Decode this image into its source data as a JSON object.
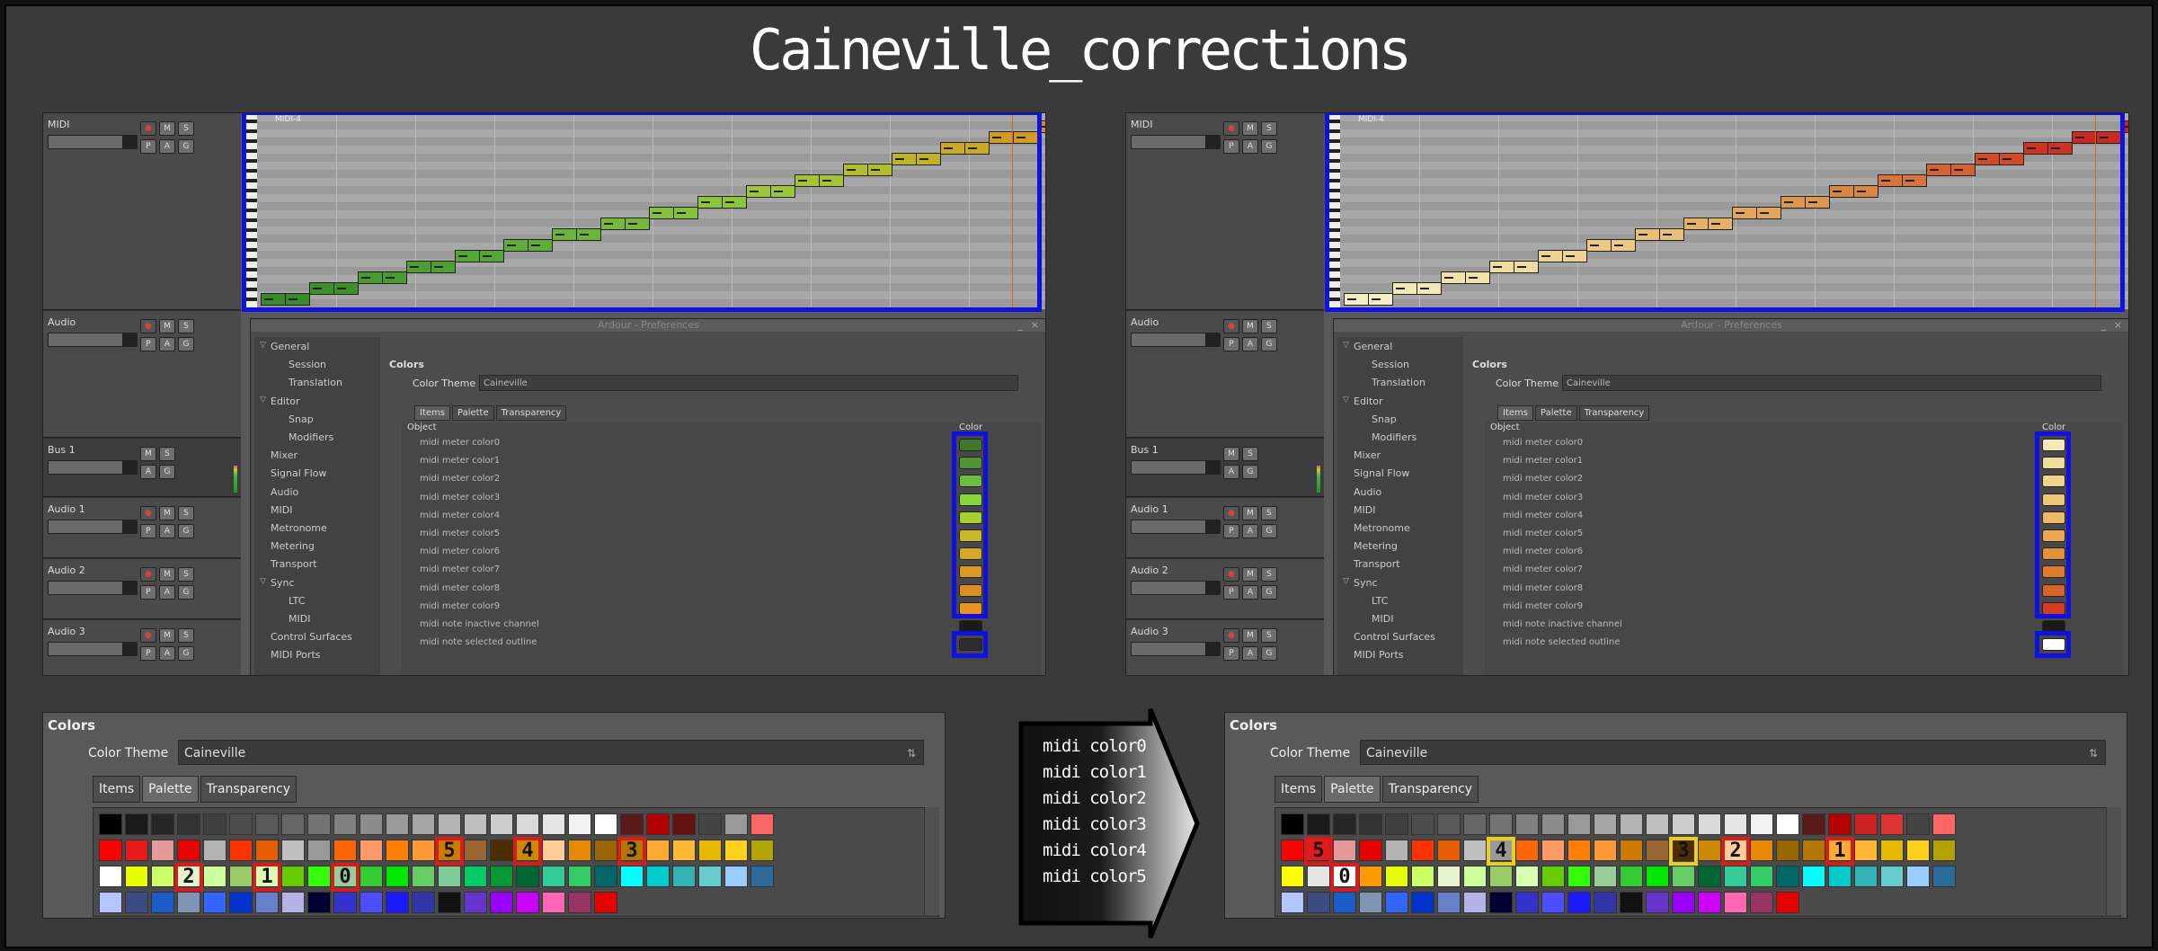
{
  "title": "Caineville_corrections",
  "track_names": [
    "MIDI",
    "Audio",
    "Bus 1",
    "Audio 1",
    "Audio 2",
    "Audio 3"
  ],
  "track_buttons": {
    "m": "M",
    "s": "S",
    "p": "P",
    "a": "A",
    "g": "G"
  },
  "region_name": "MIDI-4",
  "prefs": {
    "window_title": "Ardour - Preferences",
    "min_btn": "_",
    "close_btn": "×",
    "tree": [
      {
        "label": "General",
        "level": 0,
        "expander": true
      },
      {
        "label": "Session",
        "level": 1
      },
      {
        "label": "Translation",
        "level": 1
      },
      {
        "label": "Editor",
        "level": 0,
        "expander": true
      },
      {
        "label": "Snap",
        "level": 1
      },
      {
        "label": "Modifiers",
        "level": 1
      },
      {
        "label": "Mixer",
        "level": 0
      },
      {
        "label": "Signal Flow",
        "level": 0
      },
      {
        "label": "Audio",
        "level": 0
      },
      {
        "label": "MIDI",
        "level": 0
      },
      {
        "label": "Metronome",
        "level": 0
      },
      {
        "label": "Metering",
        "level": 0
      },
      {
        "label": "Transport",
        "level": 0
      },
      {
        "label": "Sync",
        "level": 0,
        "expander": true
      },
      {
        "label": "LTC",
        "level": 1
      },
      {
        "label": "MIDI",
        "level": 1
      },
      {
        "label": "Control Surfaces",
        "level": 0
      },
      {
        "label": "MIDI Ports",
        "level": 0
      }
    ],
    "section": "Colors",
    "theme_label": "Color Theme",
    "theme_value": "Caineville",
    "tabs": [
      "Items",
      "Palette",
      "Transparency"
    ],
    "col_object": "Object",
    "col_color": "Color",
    "objects": [
      "midi meter color0",
      "midi meter color1",
      "midi meter color2",
      "midi meter color3",
      "midi meter color4",
      "midi meter color5",
      "midi meter color6",
      "midi meter color7",
      "midi meter color8",
      "midi meter color9",
      "midi note inactive channel",
      "midi note selected outline"
    ]
  },
  "left_swatches": [
    "#3f7a2a",
    "#4e9434",
    "#6cbf3e",
    "#8ad43c",
    "#a7cf32",
    "#c8b92a",
    "#d4a82a",
    "#d99a25",
    "#de8e22",
    "#e69520",
    "#1a1a1a",
    "#2c2c2c"
  ],
  "right_swatches": [
    "#f2e8b8",
    "#f0dd9e",
    "#efd48a",
    "#edc878",
    "#ecba63",
    "#e8a84f",
    "#e29138",
    "#dd7b2c",
    "#d96325",
    "#d83d22",
    "#1a1a1a",
    "#ffffff"
  ],
  "left_notes_colors": [
    "#3a8a2a",
    "#3f8f2b",
    "#479a30",
    "#4d9e33",
    "#56a636",
    "#5fae38",
    "#6bb43a",
    "#77ba3b",
    "#84c03c",
    "#8fc53b",
    "#9cc637",
    "#a6c432",
    "#b2bd2c",
    "#bfb428",
    "#c9a824",
    "#d19c22",
    "#d69020"
  ],
  "right_notes_colors": [
    "#f6eec5",
    "#f4e8b6",
    "#f2e2aa",
    "#f0dc9e",
    "#eed493",
    "#ecca85",
    "#e9bf78",
    "#e6b26a",
    "#e2a55d",
    "#de974f",
    "#da8743",
    "#d77439",
    "#d46131",
    "#d04b2a",
    "#cc3323",
    "#c92a22",
    "#c62220"
  ],
  "bottom": {
    "section": "Colors",
    "theme_label": "Color Theme",
    "theme_value": "Caineville",
    "tabs": [
      "Items",
      "Palette",
      "Transparency"
    ]
  },
  "left_palette": [
    [
      "#000000",
      "#1a1a1a",
      "#262626",
      "#333333",
      "#404040",
      "#4d4d4d",
      "#595959",
      "#666666",
      "#737373",
      "#808080",
      "#8c8c8c",
      "#999999",
      "#a6a6a6",
      "#b3b3b3",
      "#bfbfbf",
      "#cccccc",
      "#d9d9d9",
      "#e6e6e6",
      "#f2f2f2",
      "#ffffff",
      "#5a1a1a",
      "#b30000",
      "#661111",
      "#444444",
      "#999999",
      "#ff6666"
    ],
    [
      "#ff0000",
      "#e61a1a",
      "#e69999",
      "#e60000",
      "#b3b3b3",
      "#ff3300",
      "#e65c00",
      "#bfbfbf",
      "#999999",
      "#ff6600",
      "#ff9966",
      "#ff8000",
      "#ff9933",
      "#cc7a00",
      "#996633",
      "#4d2e00",
      "#cc8800",
      "#ffcc99",
      "#e68a00",
      "#996600",
      "#b37700",
      "#ffaa33",
      "#ffb833",
      "#e6b800",
      "#ffd11a",
      "#b3a300"
    ],
    [
      "#ffffff",
      "#e6ff00",
      "#ccff66",
      "#e6f2cc",
      "#ccff99",
      "#99cc66",
      "#d9ffb3",
      "#66cc00",
      "#33ff00",
      "#99cc99",
      "#33cc33",
      "#00e600",
      "#66cc66",
      "#80cc99",
      "#00cc66",
      "#009933",
      "#006633",
      "#33cc99",
      "#33cc66",
      "#006666",
      "#00ffff",
      "#00cccc",
      "#33b3b3",
      "#66cccc",
      "#99ccff",
      "#2a6b99"
    ],
    [
      "#b3c6ff",
      "#3d4c80",
      "#1a5cc9",
      "#8094b3",
      "#3366ff",
      "#0033cc",
      "#6680cc",
      "#b3b3e6",
      "#000033",
      "#3333cc",
      "#4d4dff",
      "#1a1aff",
      "#3333aa",
      "#111111",
      "#6633cc",
      "#9900ff",
      "#cc00ff",
      "#ff66b3",
      "#993366",
      "#e60000"
    ]
  ],
  "right_palette": [
    [
      "#000000",
      "#1a1a1a",
      "#262626",
      "#333333",
      "#404040",
      "#4d4d4d",
      "#595959",
      "#666666",
      "#737373",
      "#808080",
      "#8c8c8c",
      "#999999",
      "#a6a6a6",
      "#b3b3b3",
      "#bfbfbf",
      "#cccccc",
      "#d9d9d9",
      "#e6e6e6",
      "#f2f2f2",
      "#ffffff",
      "#5a1a1a",
      "#b30000",
      "#cc2222",
      "#dd3333",
      "#444444",
      "#ff6666"
    ],
    [
      "#ff0000",
      "#e61a1a",
      "#e69999",
      "#e60000",
      "#b3b3b3",
      "#ff3300",
      "#e65c00",
      "#bfbfbf",
      "#999999",
      "#ff6600",
      "#ff9966",
      "#ff8000",
      "#ff9933",
      "#cc7a00",
      "#996633",
      "#4d2e00",
      "#cc8800",
      "#ffcc99",
      "#e68a00",
      "#996600",
      "#b37700",
      "#ffaa33",
      "#ffb833",
      "#e6b800",
      "#ffd11a",
      "#b3a300"
    ],
    [
      "#ffff00",
      "#e6e6e6",
      "#ffffff",
      "#ff9900",
      "#e6ff00",
      "#ccff66",
      "#e6f2cc",
      "#ccff99",
      "#99cc66",
      "#d9ffb3",
      "#66cc00",
      "#33ff00",
      "#99cc99",
      "#33cc33",
      "#00e600",
      "#66cc66",
      "#006633",
      "#33cc99",
      "#33cc66",
      "#006666",
      "#00ffff",
      "#00cccc",
      "#33b3b3",
      "#66cccc",
      "#99ccff",
      "#2a6b99"
    ],
    [
      "#b3c6ff",
      "#3d4c80",
      "#1a5cc9",
      "#8094b3",
      "#3366ff",
      "#0033cc",
      "#6680cc",
      "#b3b3e6",
      "#000033",
      "#3333cc",
      "#4d4dff",
      "#1a1aff",
      "#3333aa",
      "#111111",
      "#6633cc",
      "#9900ff",
      "#cc00ff",
      "#ff66b3",
      "#993366",
      "#e60000"
    ]
  ],
  "left_marks": [
    {
      "label": "5",
      "row": 1,
      "col": 13,
      "kind": "red"
    },
    {
      "label": "4",
      "row": 1,
      "col": 16,
      "kind": "red"
    },
    {
      "label": "3",
      "row": 1,
      "col": 20,
      "kind": "red"
    },
    {
      "label": "2",
      "row": 2,
      "col": 3,
      "kind": "red"
    },
    {
      "label": "1",
      "row": 2,
      "col": 6,
      "kind": "red"
    },
    {
      "label": "0",
      "row": 2,
      "col": 9,
      "kind": "red"
    }
  ],
  "right_marks": [
    {
      "label": "5",
      "row": 1,
      "col": 1,
      "kind": "red"
    },
    {
      "label": "4",
      "row": 1,
      "col": 8,
      "kind": "yellow"
    },
    {
      "label": "3",
      "row": 1,
      "col": 15,
      "kind": "yellow"
    },
    {
      "label": "2",
      "row": 1,
      "col": 17,
      "kind": "red"
    },
    {
      "label": "1",
      "row": 1,
      "col": 21,
      "kind": "red"
    },
    {
      "label": "0",
      "row": 2,
      "col": 2,
      "kind": "red"
    }
  ],
  "arrow_lines": [
    "midi color0",
    "midi color1",
    "midi color2",
    "midi color3",
    "midi color4",
    "midi color5"
  ]
}
